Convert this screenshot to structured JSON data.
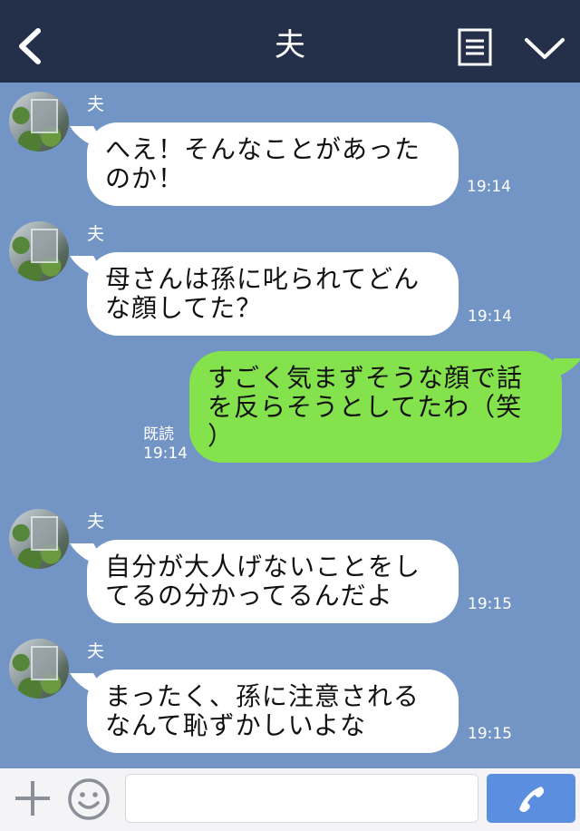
{
  "header": {
    "title": "夫"
  },
  "messages": [
    {
      "sender": "夫",
      "lines": [
        "へえ！そんなことがあった",
        "のか！"
      ],
      "time": "19:14"
    },
    {
      "sender": "夫",
      "lines": [
        "母さんは孫に叱られてどん",
        "な顔してた？"
      ],
      "time": "19:14"
    },
    {
      "lines": [
        "すごく気まずそうな顔で話",
        "を反らそうとしてたわ（笑",
        "）"
      ],
      "read_label": "既読",
      "time": "19:14"
    },
    {
      "sender": "夫",
      "lines": [
        "自分が大人げないことをし",
        "てるの分かってるんだよ"
      ],
      "time": "19:15"
    },
    {
      "sender": "夫",
      "lines": [
        "まったく、孫に注意される",
        "なんて恥ずかしいよな"
      ],
      "time": "19:15"
    }
  ],
  "footer": {
    "input_placeholder": ""
  },
  "colors": {
    "header_bg": "#243049",
    "chat_bg": "#7395c5",
    "outgoing_bubble": "#84e34c",
    "call_button": "#5c8ee0"
  }
}
